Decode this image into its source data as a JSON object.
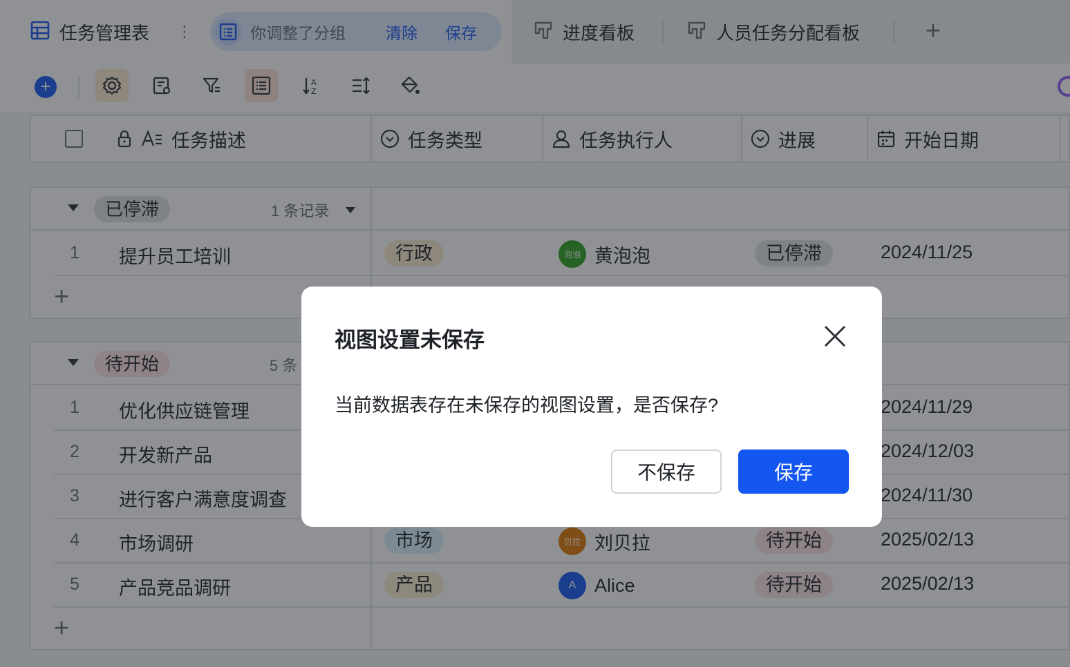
{
  "tabs": {
    "main_label": "任务管理表",
    "notice": "你调整了分组",
    "clear_label": "清除",
    "save_label": "保存",
    "view2_label": "进度看板",
    "view3_label": "人员任务分配看板"
  },
  "columns": {
    "desc": "任务描述",
    "type": "任务类型",
    "assignee": "任务执行人",
    "progress": "进展",
    "start": "开始日期"
  },
  "groups": [
    {
      "label": "已停滞",
      "count": "1 条记录",
      "rows": [
        {
          "num": "1",
          "desc": "提升员工培训",
          "type": "行政",
          "assignee": "黄泡泡",
          "avatar_text": "泡泡",
          "status": "已停滞",
          "date": "2024/11/25"
        }
      ]
    },
    {
      "label": "待开始",
      "count": "5 条",
      "rows": [
        {
          "num": "1",
          "desc": "优化供应链管理",
          "date": "2024/11/29"
        },
        {
          "num": "2",
          "desc": "开发新产品",
          "date": "2024/12/03"
        },
        {
          "num": "3",
          "desc": "进行客户满意度调查",
          "date": "2024/11/30"
        },
        {
          "num": "4",
          "desc": "市场调研",
          "type": "市场",
          "assignee": "刘贝拉",
          "avatar_text": "贝拉",
          "status": "待开始",
          "date": "2025/02/13"
        },
        {
          "num": "5",
          "desc": "产品竞品调研",
          "type": "产品",
          "assignee": "Alice",
          "avatar_text": "A",
          "status": "待开始",
          "date": "2025/02/13"
        }
      ]
    }
  ],
  "dialog": {
    "title": "视图设置未保存",
    "body": "当前数据表存在未保存的视图设置，是否保存?",
    "cancel_label": "不保存",
    "confirm_label": "保存"
  },
  "colors": {
    "accent": "#1456f0",
    "tag_stalled": "#dee0e3",
    "tag_pending": "#fde2e2",
    "tag_admin": "#fdecce",
    "tag_market": "#d9f3fd",
    "tag_product": "#faf1d1"
  },
  "icons": [
    "table-icon",
    "list-icon",
    "kanban-icon",
    "plus-icon",
    "gear-icon",
    "form-icon",
    "filter-icon",
    "group-icon",
    "sort-icon",
    "row-height-icon",
    "paint-icon",
    "lock-icon",
    "text-field-icon",
    "select-icon",
    "person-icon",
    "calendar-icon",
    "close-icon"
  ]
}
